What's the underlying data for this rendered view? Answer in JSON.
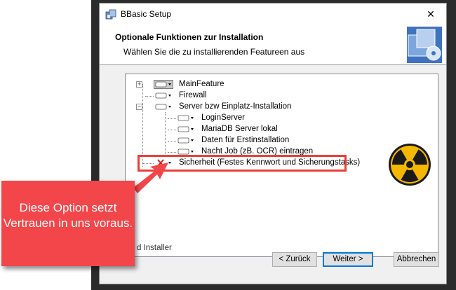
{
  "window": {
    "title": "BBasic Setup",
    "close_glyph": "✕"
  },
  "header": {
    "title": "Optionale Funktionen zur Installation",
    "subtitle": "Wählen Sie die zu installierenden Featureen aus"
  },
  "features": [
    {
      "label": "MainFeature",
      "state": "installed"
    },
    {
      "label": "Firewall",
      "state": "installed"
    },
    {
      "label": "Server bzw Einplatz-Installation",
      "state": "installed"
    },
    {
      "label": "LoginServer",
      "state": "installed"
    },
    {
      "label": "MariaDB Server lokal",
      "state": "installed"
    },
    {
      "label": "Daten für Erstinstallation",
      "state": "installed"
    },
    {
      "label": "Nacht Job (zB. OCR) eintragen",
      "state": "installed"
    },
    {
      "label": "Sicherheit (Festes Kennwort und Sicherungstasks)",
      "state": "unavailable"
    }
  ],
  "footer": {
    "installer_text": "d Installer",
    "back_label": "< Zurück",
    "next_label": "Weiter >",
    "cancel_label": "Abbrechen"
  },
  "callout": {
    "text": "Diese Option setzt Vertrauen in uns voraus."
  },
  "colors": {
    "callout": "#f2464a",
    "highlight": "#e8403a",
    "radiation_yellow": "#f5b800"
  }
}
